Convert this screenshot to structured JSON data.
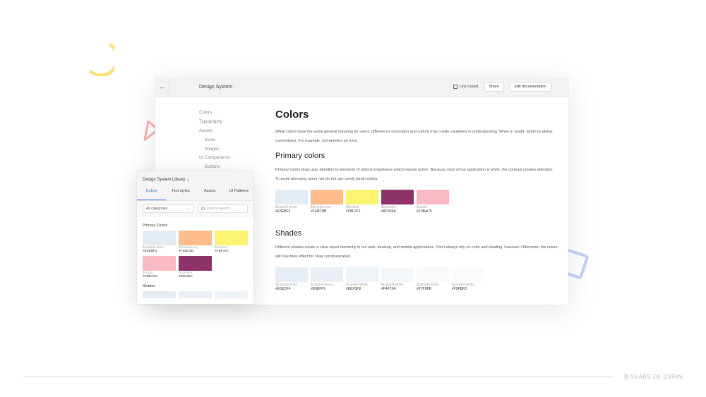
{
  "window": {
    "back_icon": "arrow-left-icon",
    "title": "Design System",
    "link_copied": "Link copied",
    "share_label": "Share",
    "edit_doc_label": "Edit documentation"
  },
  "nav": {
    "items": [
      {
        "label": "Colors",
        "sub": false
      },
      {
        "label": "Typography",
        "sub": false
      },
      {
        "label": "Assets",
        "sub": false
      },
      {
        "label": "Icons",
        "sub": true
      },
      {
        "label": "Images",
        "sub": true
      },
      {
        "label": "UI Components",
        "sub": false
      },
      {
        "label": "Buttons",
        "sub": true
      }
    ]
  },
  "content": {
    "title": "Colors",
    "intro": "While colors have the same general meaning for users, differences in location and culture may create variations in understanding. When in doubt, abide by global conventions. For example, red denotes an error.",
    "primary_heading": "Primary colors",
    "primary_text": "Primary colors draw user attention to elements of utmost importance which require action. Because most of our application is white, the contrast creates attention. To avoid annoying users, we do not use overly harsh colors.",
    "primary_swatches": [
      {
        "name": "$catskill-white",
        "hex": "#E3EBF3",
        "color": "#E3EBF3"
      },
      {
        "name": "$chardonnay",
        "hex": "#FEBC8B",
        "color": "#FEBC8B"
      },
      {
        "name": "$festival",
        "hex": "#FBF471",
        "color": "#FBF471"
      },
      {
        "name": "$camelot",
        "hex": "#8D336A",
        "color": "#8D336A"
      },
      {
        "name": "$cupid",
        "hex": "#F9BAC5",
        "color": "#F9BAC5"
      }
    ],
    "shades_heading": "Shades",
    "shades_text": "Different shades create a clear visual hierarchy in our web, desktop, and mobile applications. Don't always rely on color and shading, however. Otherwise, the colors will lose their effect for clear communication.",
    "shade_swatches": [
      {
        "name": "$catskill-white",
        "hex": "#E6EDF4",
        "color": "#E6EDF4"
      },
      {
        "name": "$catskill-white...",
        "hex": "#E9EFF5",
        "color": "#E9EFF5"
      },
      {
        "name": "$catskill-white...",
        "hex": "#EEF3F8",
        "color": "#EEF3F8"
      },
      {
        "name": "$catskill-white",
        "hex": "#F4F7FA",
        "color": "#F4F7FA"
      },
      {
        "name": "$catskill-white",
        "hex": "#F7F9FB",
        "color": "#F7F9FB"
      },
      {
        "name": "$catskill-white...",
        "hex": "#F9FBFD",
        "color": "#F9FBFD"
      }
    ]
  },
  "library": {
    "title": "Design System Library",
    "title_chevron": "⌄",
    "tabs": [
      "Colors",
      "Text styles",
      "Assets",
      "UI Patterns"
    ],
    "category_select": "All categories",
    "search_placeholder": "Type to search...",
    "primary_section": "Primary Colors",
    "swatches": [
      {
        "name": "$catskill-white",
        "hex": "#E3EBF3",
        "color": "#E3EBF3"
      },
      {
        "name": "$chardonnay",
        "hex": "#FEBC8B",
        "color": "#FEBC8B"
      },
      {
        "name": "$festival",
        "hex": "#FBF471",
        "color": "#FBF471"
      },
      {
        "name": "$cupid",
        "hex": "#F9BAC5",
        "color": "#F9BAC5"
      },
      {
        "name": "$camelot",
        "hex": "#8D336A",
        "color": "#8D336A"
      }
    ],
    "shades_section": "Shades",
    "shade_colors": [
      "#E6EDF4",
      "#E9EFF5",
      "#EEF3F8"
    ]
  },
  "footer": {
    "number": "8",
    "text": "YEARS OF UXPIN"
  },
  "colors": {
    "accent_blue": "#2C6FE0",
    "deco_yellow": "#F7E27A",
    "deco_red": "#F6A6A6",
    "deco_blue": "#A9BCF5"
  }
}
